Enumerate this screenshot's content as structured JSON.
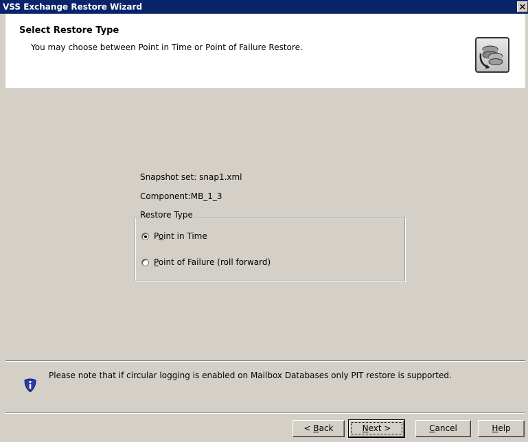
{
  "window": {
    "title": "VSS Exchange Restore Wizard",
    "close_label": "×"
  },
  "header": {
    "title": "Select Restore Type",
    "subtitle": "You may choose between Point in Time or Point of Failure Restore.",
    "icon": "restore-disks-icon"
  },
  "info": {
    "snapshot": "Snapshot set: snap1.xml",
    "component": "Component:MB_1_3"
  },
  "restore_type": {
    "legend": "Restore Type",
    "options": [
      {
        "prefix": "P",
        "mnemonic": "o",
        "rest": "int in Time",
        "checked": true
      },
      {
        "prefix": "",
        "mnemonic": "P",
        "rest": "oint of Failure (roll forward)",
        "checked": false
      }
    ]
  },
  "note": {
    "text": "Please note that if circular logging is enabled on Mailbox Databases only PIT restore is supported.",
    "icon": "info-shield-icon"
  },
  "buttons": {
    "back": {
      "pre": "< ",
      "mnemonic": "B",
      "post": "ack"
    },
    "next": {
      "pre": "",
      "mnemonic": "N",
      "post": "ext >"
    },
    "cancel": {
      "pre": "",
      "mnemonic": "C",
      "post": "ancel"
    },
    "help": {
      "pre": "",
      "mnemonic": "H",
      "post": "elp"
    }
  }
}
